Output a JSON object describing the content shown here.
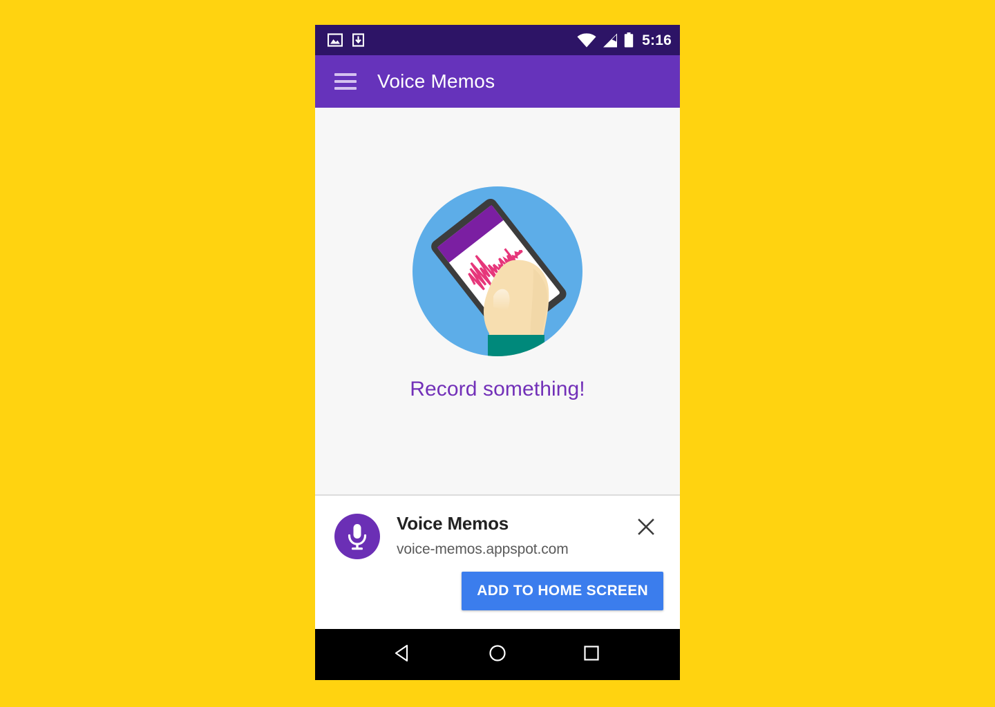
{
  "background_color": "#FFD310",
  "status_bar": {
    "background_color": "#2D1466",
    "time": "5:16",
    "left_icons": [
      "image-icon",
      "download-icon"
    ],
    "right_icons": [
      "wifi-icon",
      "cell-signal-icon",
      "battery-icon"
    ]
  },
  "toolbar": {
    "background_color": "#6633BB",
    "menu_icon": "hamburger-menu-icon",
    "title": "Voice Memos"
  },
  "content": {
    "background_color": "#F7F7F7",
    "illustration": {
      "name": "hand-holding-phone-recording-illustration",
      "circle_color": "#5DADE8",
      "phone_frame_color": "#3C3C3C",
      "phone_appbar_color": "#7B1FA2",
      "waveform_color": "#E6367A",
      "skin_color": "#F7DEB0",
      "sleeve_color": "#00897B"
    },
    "empty_state_text": "Record something!",
    "empty_state_text_color": "#7230B8"
  },
  "install_banner": {
    "background_color": "#FFFFFF",
    "app_icon": "microphone-icon",
    "app_icon_background": "#6B2FB5",
    "app_name": "Voice Memos",
    "app_url": "voice-memos.appspot.com",
    "close_icon": "close-icon",
    "cta_label": "ADD TO HOME SCREEN",
    "cta_color": "#3B7DED"
  },
  "nav_bar": {
    "background_color": "#000000",
    "buttons": [
      {
        "name": "back-button",
        "icon": "triangle-back-icon"
      },
      {
        "name": "home-button",
        "icon": "circle-home-icon"
      },
      {
        "name": "recents-button",
        "icon": "square-recents-icon"
      }
    ]
  }
}
